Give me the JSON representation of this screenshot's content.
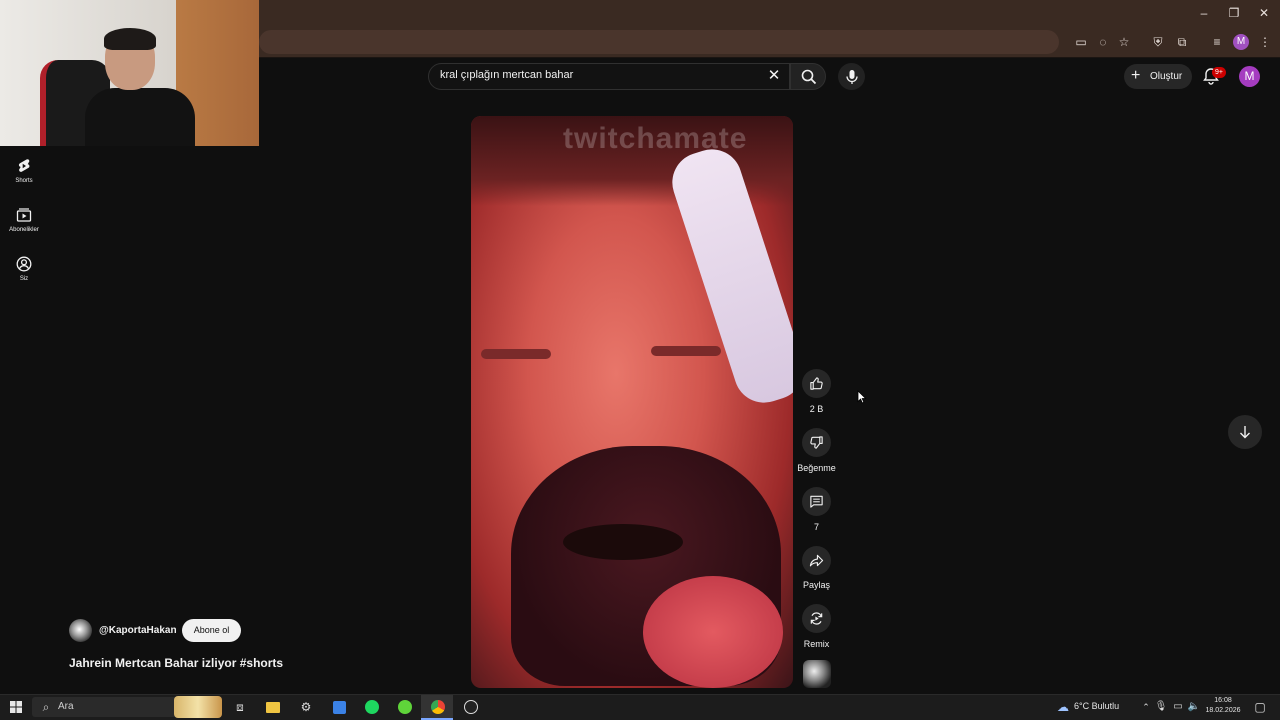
{
  "browser": {
    "window_controls": [
      "–",
      "❐",
      "✕"
    ]
  },
  "search": {
    "query": "kral çıplağın mertcan bahar"
  },
  "header": {
    "create_label": "Oluştur",
    "notification_badge": "9+",
    "avatar_letter": "M",
    "browser_profile_letter": "M"
  },
  "sidebar": {
    "items": [
      {
        "label": "Shorts",
        "icon": "shorts-icon"
      },
      {
        "label": "Abonelikler",
        "icon": "subscriptions-icon"
      },
      {
        "label": "Siz",
        "icon": "you-icon"
      }
    ]
  },
  "video": {
    "watermark": "twitchamate"
  },
  "actions": {
    "like_count": "2 B",
    "dislike_label": "Beğenme",
    "comment_count": "7",
    "share_label": "Paylaş",
    "remix_label": "Remix"
  },
  "channel": {
    "name": "@KaportaHakan",
    "subscribe_label": "Abone ol",
    "video_title": "Jahrein Mertcan Bahar izliyor #shorts"
  },
  "taskbar": {
    "search_placeholder": "Ara",
    "weather": "6°C  Bulutlu",
    "time": "16:08",
    "date": "18.02.2026"
  }
}
